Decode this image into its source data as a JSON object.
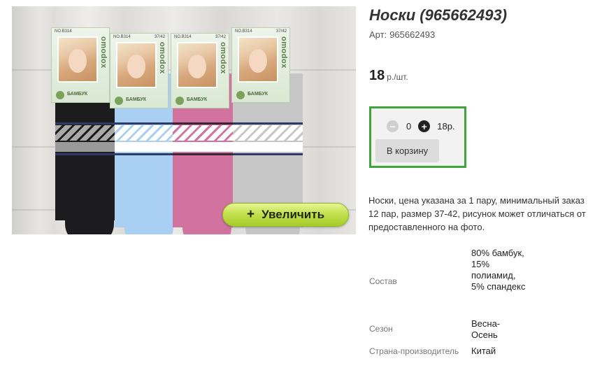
{
  "product": {
    "title": "Носки (965662493)",
    "article_label": "Арт:",
    "article_value": "965662493",
    "price_value": "18",
    "price_unit": "р./шт.",
    "description": "Носки, цена указана за 1 пару, минимальный заказ 12 пар, размер 37-42, рисунок может отличаться от предоставленного на фото."
  },
  "image": {
    "zoom_label": "Увеличить",
    "zoom_icon": "+",
    "package": {
      "code": "NO.B314",
      "size": "37/42",
      "brand": "omodox",
      "material": "БАМБУК"
    }
  },
  "cart": {
    "minus_icon": "−",
    "quantity": "0",
    "plus_icon": "+",
    "sum": "18р.",
    "add_label": "В корзину"
  },
  "specs": [
    {
      "label": "Состав",
      "value": "80% бамбук, 15% полиамид, 5% спандекс"
    },
    {
      "label": "Сезон",
      "value": "Весна-Осень"
    },
    {
      "label": "Страна-производитель",
      "value": "Китай"
    }
  ],
  "colors": {
    "cart_border": "#3fa43b",
    "zoom_button": "#c3e14d"
  }
}
